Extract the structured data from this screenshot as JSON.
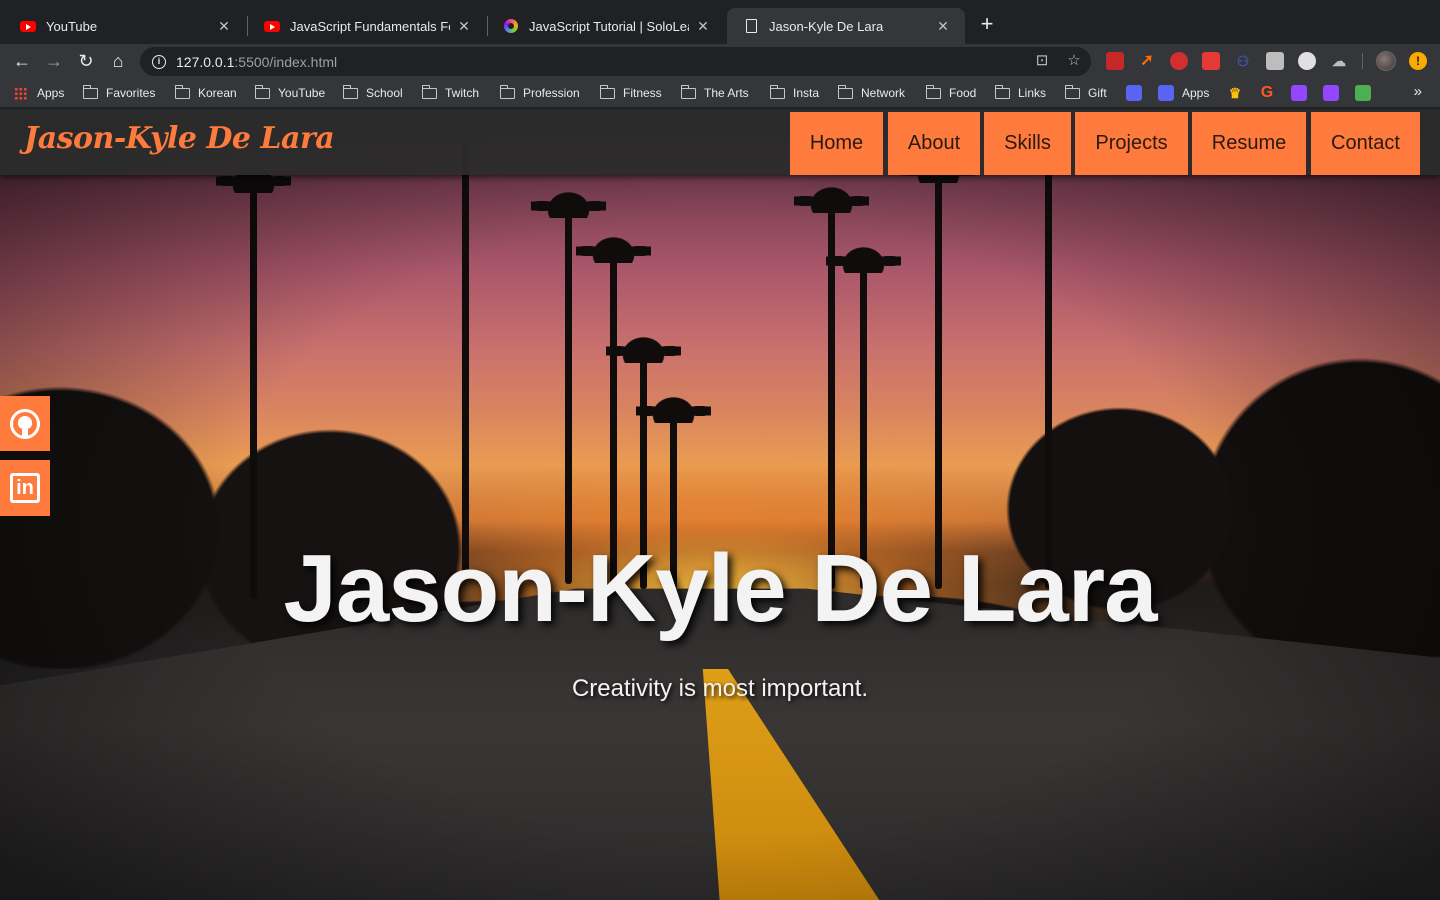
{
  "browser": {
    "tabs": [
      {
        "title": "YouTube",
        "favicon": "youtube-icon"
      },
      {
        "title": "JavaScript Fundamentals For E",
        "favicon": "youtube-icon"
      },
      {
        "title": "JavaScript Tutorial | SoloLearn",
        "favicon": "sololearn-icon"
      },
      {
        "title": "Jason-Kyle De Lara",
        "favicon": "document-icon",
        "active": true
      }
    ],
    "close_glyph": "✕",
    "newtab_glyph": "+",
    "url_host": "127.0.0.1",
    "url_path": ":5500/index.html",
    "bookmarks": [
      {
        "label": "Apps",
        "icon": "apps-grid-icon"
      },
      {
        "label": "Favorites",
        "icon": "folder-icon"
      },
      {
        "label": "Korean",
        "icon": "folder-icon"
      },
      {
        "label": "YouTube",
        "icon": "folder-icon"
      },
      {
        "label": "School",
        "icon": "folder-icon"
      },
      {
        "label": "Twitch",
        "icon": "folder-icon"
      },
      {
        "label": "Profession",
        "icon": "folder-icon"
      },
      {
        "label": "Fitness",
        "icon": "folder-icon"
      },
      {
        "label": "The Arts",
        "icon": "folder-icon"
      },
      {
        "label": "Insta",
        "icon": "folder-icon"
      },
      {
        "label": "Network",
        "icon": "folder-icon"
      },
      {
        "label": "Food",
        "icon": "folder-icon"
      },
      {
        "label": "Links",
        "icon": "folder-icon"
      },
      {
        "label": "Gift",
        "icon": "folder-icon"
      },
      {
        "label": "Apps",
        "icon": "discord-icon"
      }
    ],
    "bookmarks_more": "»"
  },
  "site": {
    "brand": "Jason-Kyle De Lara",
    "nav": [
      "Home",
      "About",
      "Skills",
      "Projects",
      "Resume",
      "Contact"
    ],
    "hero_title": "Jason-Kyle De Lara",
    "hero_subtitle": "Creativity is most important.",
    "social": [
      "github-icon",
      "linkedin-icon"
    ],
    "linkedin_glyph": "in"
  },
  "colors": {
    "accent": "#ff7a3d",
    "browser_bg": "#202124",
    "toolbar_bg": "#35363a"
  }
}
